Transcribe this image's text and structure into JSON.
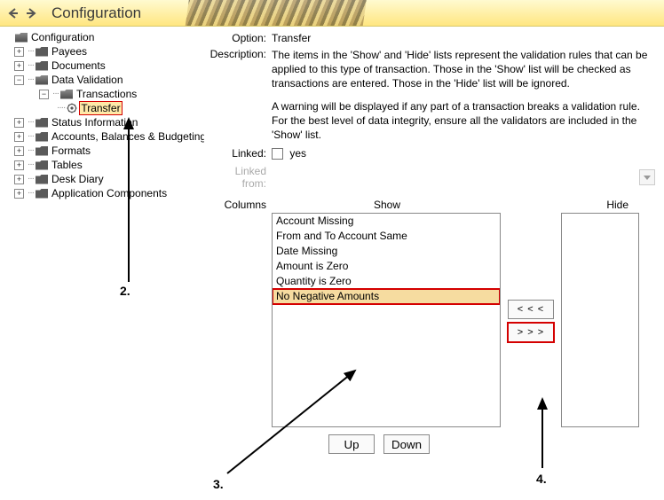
{
  "header": {
    "title": "Configuration"
  },
  "tree": {
    "root": "Configuration",
    "items": {
      "payees": "Payees",
      "documents": "Documents",
      "datavalidation": "Data Validation",
      "transactions": "Transactions",
      "transfer": "Transfer",
      "statusinfo": "Status Information",
      "accounts": "Accounts, Balances & Budgeting",
      "formats": "Formats",
      "tables": "Tables",
      "deskdiary": "Desk Diary",
      "appcomponents": "Application Components"
    }
  },
  "detail": {
    "labels": {
      "option": "Option:",
      "description": "Description:",
      "linked": "Linked:",
      "linkedfrom": "Linked from:",
      "columns": "Columns",
      "show": "Show",
      "hide": "Hide"
    },
    "option_value": "Transfer",
    "description_p1": "The items in the 'Show' and 'Hide' lists represent the validation rules that can be applied to this type of transaction. Those in the 'Show' list will be checked as transactions are entered. Those in the 'Hide' list will be ignored.",
    "description_p2": "A warning will be displayed if any part of a transaction breaks a validation rule. For the best level of data integrity, ensure all the validators are included in the 'Show' list.",
    "linked_yes": "yes",
    "show_items": [
      "Account Missing",
      "From and To Account Same",
      "Date Missing",
      "Amount is Zero",
      "Quantity is Zero",
      "No Negative Amounts"
    ],
    "buttons": {
      "move_in": "< < <",
      "move_out": "> > >",
      "up": "Up",
      "down": "Down"
    }
  },
  "annotations": {
    "n2": "2.",
    "n3": "3.",
    "n4": "4."
  }
}
